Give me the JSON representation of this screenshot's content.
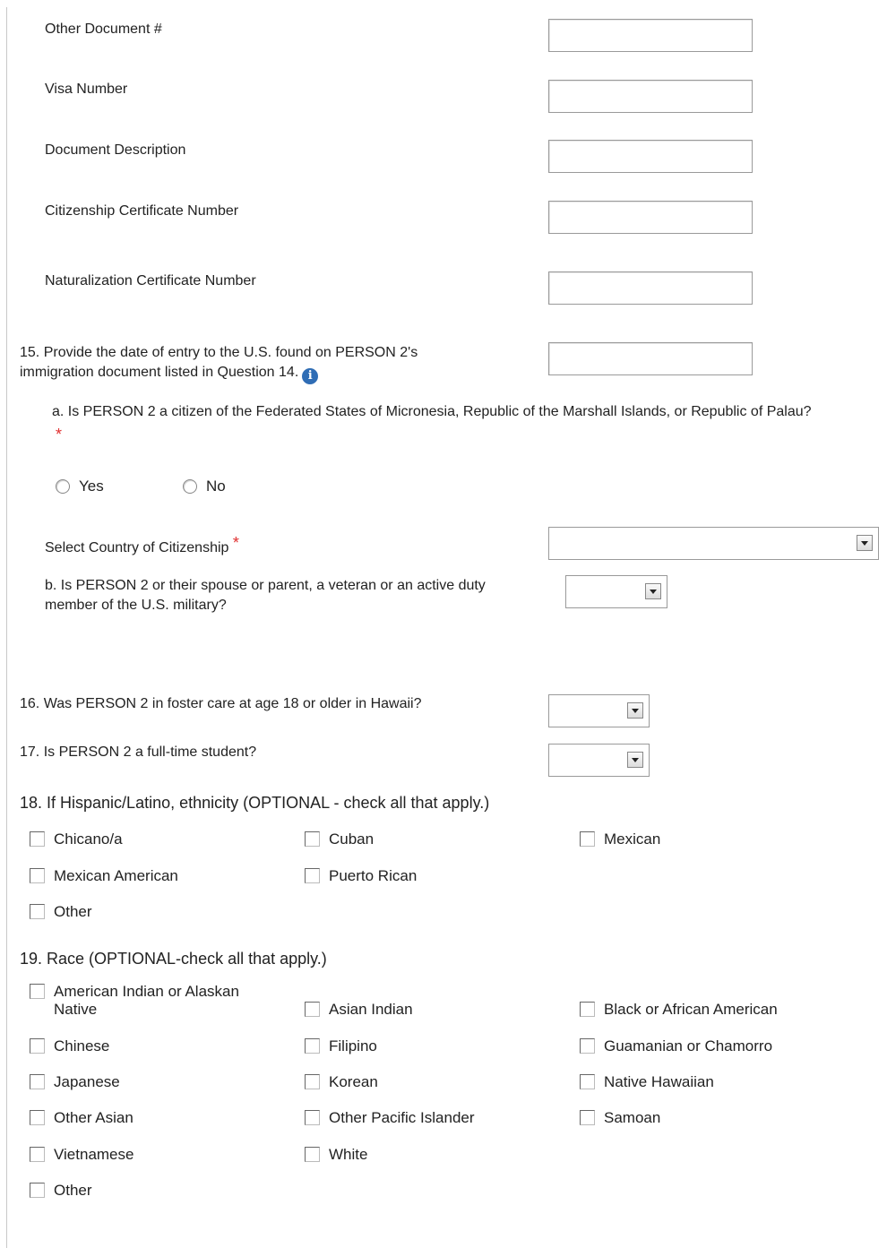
{
  "fields": {
    "other_document": "Other Document #",
    "visa_number": "Visa Number",
    "document_description": "Document Description",
    "citizenship_certificate": "Citizenship Certificate Number",
    "naturalization_certificate": "Naturalization Certificate Number"
  },
  "q15": {
    "label_line1": "15. Provide the date of entry to the U.S. found on PERSON 2's",
    "label_line2": "immigration document listed in Question 14.",
    "info_glyph": "i",
    "a_label": "a. Is PERSON 2 a citizen of the Federated States of Micronesia, Republic of the Marshall Islands, or Republic of Palau?",
    "required_mark": "*",
    "yes_label": "Yes",
    "no_label": "No",
    "country_label": "Select Country of Citizenship",
    "b_label_line1": "b. Is PERSON 2 or their spouse or parent, a veteran or an active duty",
    "b_label_line2": "member of the U.S. military?"
  },
  "q16": {
    "label": "16. Was PERSON 2 in foster care at age 18 or older in Hawaii?"
  },
  "q17": {
    "label": "17. Is PERSON 2 a full-time student?"
  },
  "q18": {
    "label": "18. If Hispanic/Latino, ethnicity (OPTIONAL - check all that apply.)",
    "options": [
      "Chicano/a",
      "Cuban",
      "Mexican",
      "Mexican American",
      "Puerto Rican",
      "Other"
    ]
  },
  "q19": {
    "label": "19. Race (OPTIONAL-check all that apply.)",
    "options": [
      "American Indian or Alaskan\nNative",
      "Asian Indian",
      "Black or African American",
      "Chinese",
      "Filipino",
      "Guamanian or Chamorro",
      "Japanese",
      "Korean",
      "Native Hawaiian",
      "Other Asian",
      "Other Pacific Islander",
      "Samoan",
      "Vietnamese",
      "White",
      "Other"
    ]
  },
  "colors": {
    "required": "#e03030",
    "info": "#2f6db5",
    "border": "#9a9a9a"
  }
}
